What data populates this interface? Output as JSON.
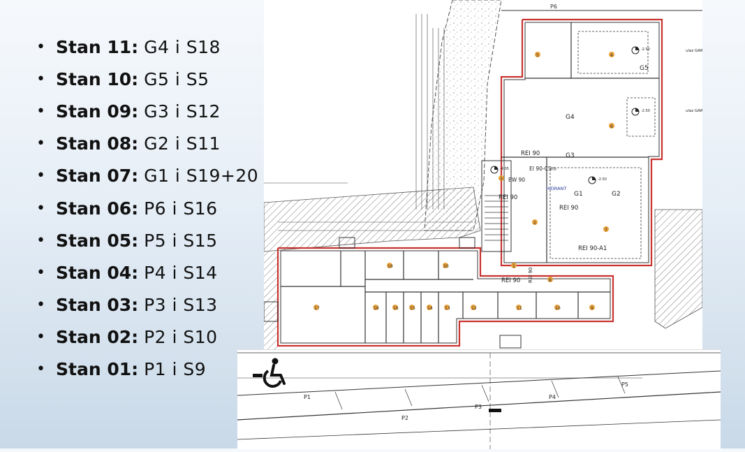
{
  "apartments": [
    {
      "label": "Stan 11",
      "sep": ":",
      "value": "G4 i S18"
    },
    {
      "label": "Stan 10",
      "sep": ":",
      "value": "G5 i S5"
    },
    {
      "label": "Stan 09",
      "sep": ":",
      "value": "G3 i S12"
    },
    {
      "label": "Stan 08",
      "sep": ":",
      "value": "G2 i S11"
    },
    {
      "label": "Stan 07",
      "sep": ":",
      "value": "G1 i S19+20"
    },
    {
      "label": "Stan 06",
      "sep": ":",
      "value": "P6 i S16"
    },
    {
      "label": "Stan 05",
      "sep": ":",
      "value": "P5 i S15"
    },
    {
      "label": "Stan 04",
      "sep": ":",
      "value": "P4 i S14"
    },
    {
      "label": "Stan 03",
      "sep": ":",
      "value": "P3 i S13"
    },
    {
      "label": "Stan 02",
      "sep": ":",
      "value": "P2 i S10"
    },
    {
      "label": "Stan 01",
      "sep": ":",
      "value": "P1 i S9"
    }
  ],
  "plan": {
    "garages": [
      "G5",
      "G4",
      "G3",
      "G2",
      "G1"
    ],
    "parking_top": "P6",
    "fire_labels": [
      "REI 90",
      "REI 90",
      "REI 90",
      "REI 90",
      "REI 90-A1",
      "REI 90",
      "EI 90-CSm",
      "EW 90"
    ],
    "hydrant": "HIDRANT",
    "entry_labels": [
      "ulaz GARAŽA",
      "ulaz GARAŽA"
    ],
    "storage_numbers": [
      "17",
      "18",
      "19",
      "20",
      "16",
      "15",
      "14",
      "13",
      "12",
      "11",
      "10",
      "9",
      "1",
      "2",
      "3",
      "4",
      "5",
      "6",
      "7",
      "8"
    ],
    "levels": [
      "-2.50",
      "-2.50",
      "-2.50",
      "-4.05"
    ]
  },
  "strip": {
    "parking": [
      "P1",
      "P2",
      "P3",
      "P4",
      "P5"
    ]
  },
  "colors": {
    "wall_red": "#c8332f",
    "line": "#333333",
    "hatch": "#7a7a7a",
    "orange_dot": "#e8a13a"
  }
}
